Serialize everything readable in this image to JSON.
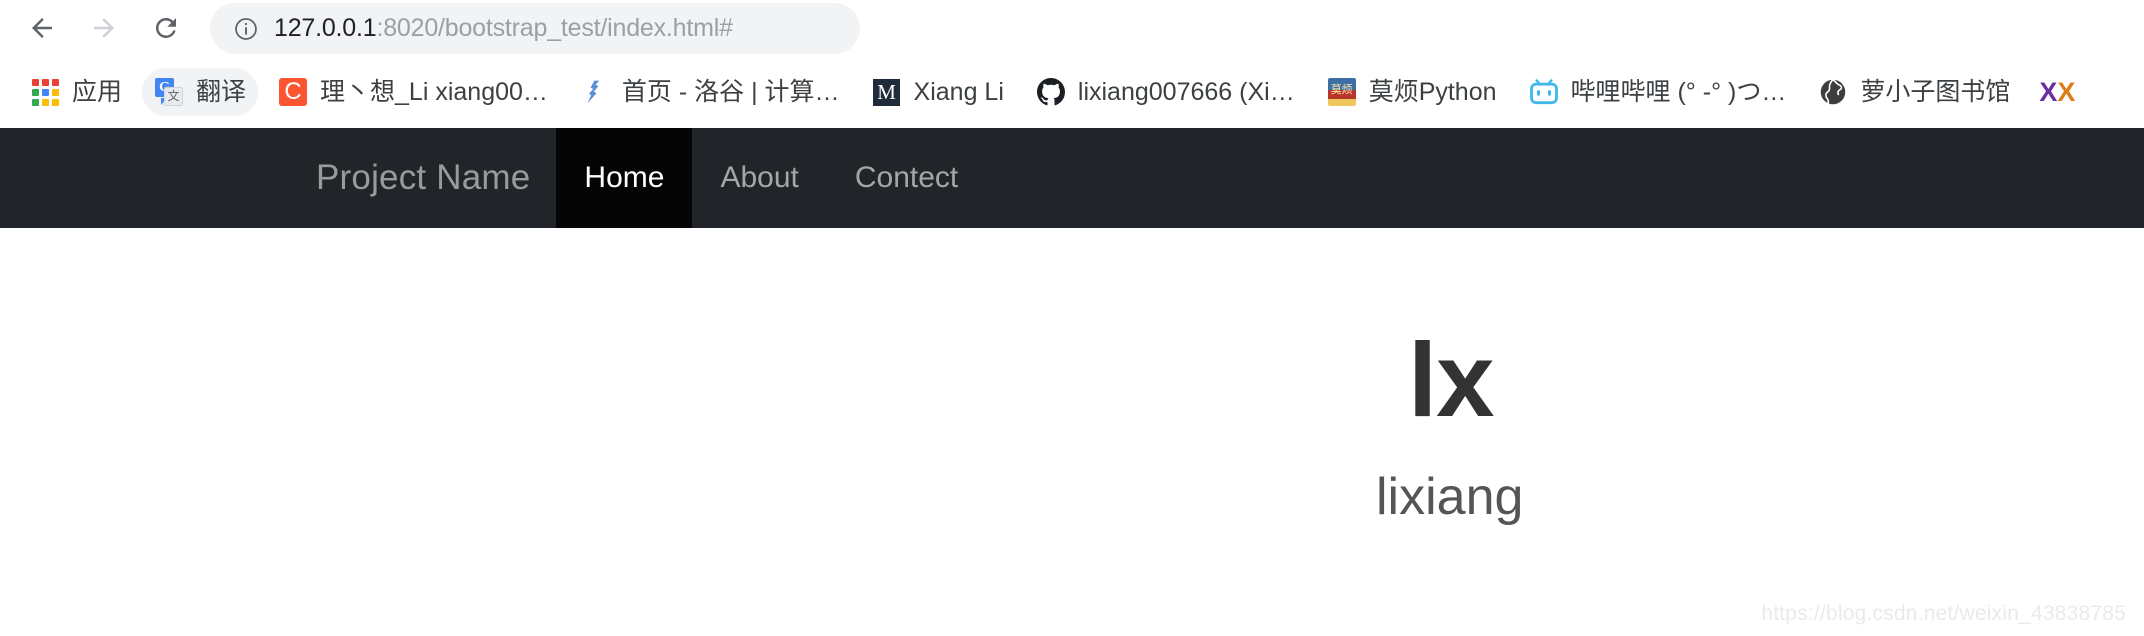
{
  "browser": {
    "back_label": "Back",
    "forward_label": "Forward",
    "reload_label": "Reload",
    "site_info_label": "View site information",
    "url_host": "127.0.0.1",
    "url_rest": ":8020/bootstrap_test/index.html#",
    "url_full": "127.0.0.1:8020/bootstrap_test/index.html#"
  },
  "bookmarks": {
    "items": [
      {
        "label": "应用",
        "icon": "google-apps-grid-icon",
        "highlighted": false
      },
      {
        "label": "翻译",
        "icon": "google-translate-icon",
        "highlighted": true
      },
      {
        "label": "理丶想_Li xiang00…",
        "icon": "csdn-icon",
        "highlighted": false
      },
      {
        "label": "首页 - 洛谷 | 计算…",
        "icon": "luogu-icon",
        "highlighted": false
      },
      {
        "label": "Xiang Li",
        "icon": "medium-m-icon",
        "highlighted": false
      },
      {
        "label": "lixiang007666 (Xi…",
        "icon": "github-icon",
        "highlighted": false
      },
      {
        "label": "莫烦Python",
        "icon": "mofan-python-icon",
        "highlighted": false
      },
      {
        "label": "哔哩哔哩 (° -° )つ…",
        "icon": "bilibili-icon",
        "highlighted": false
      },
      {
        "label": "萝小子图书馆",
        "icon": "globe-icon",
        "highlighted": false
      }
    ],
    "partial_item": {
      "label": "XX",
      "icon": "xx-icon"
    },
    "apps_grid_colors": [
      "#ea4335",
      "#ea4335",
      "#ea4335",
      "#34a853",
      "#4285f4",
      "#fbbc05",
      "#34a853",
      "#fbbc05",
      "#fbbc05"
    ],
    "translate_g": "G",
    "translate_cn": "文",
    "csdn_letter": "C",
    "medium_letter": "M",
    "mofan_letter": "莫烦"
  },
  "site_nav": {
    "brand": "Project Name",
    "links": [
      {
        "label": "Home",
        "active": true
      },
      {
        "label": "About",
        "active": false
      },
      {
        "label": "Contect",
        "active": false
      }
    ]
  },
  "hero": {
    "title": "lx",
    "subtitle": "lixiang"
  },
  "watermark": {
    "text": "https://blog.csdn.net/weixin_43838785"
  },
  "colors": {
    "navbar_bg": "#212529",
    "navbar_active_bg": "#050505",
    "brand_text": "#9a9a9a",
    "link_text": "#a6a6a6",
    "active_link_text": "#ffffff",
    "omnibox_bg": "#f1f3f4",
    "url_host_text": "#202124",
    "url_rest_text": "#9aa0a6",
    "hero_title": "#333333",
    "hero_subtitle": "#555555",
    "watermark": "#e9eaec"
  }
}
